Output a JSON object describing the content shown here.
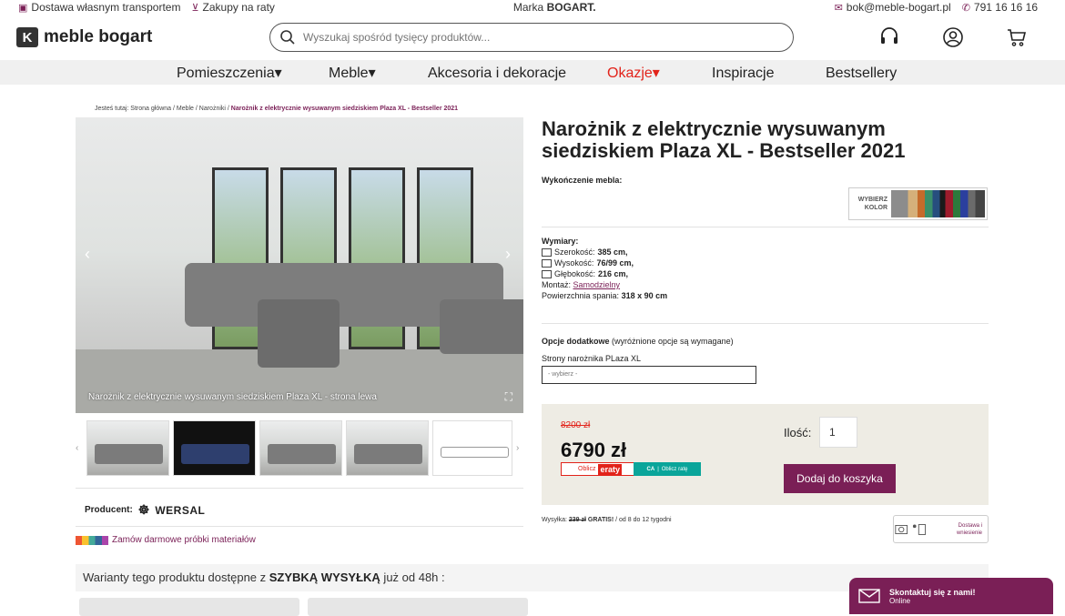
{
  "topbar": {
    "delivery": "Dostawa własnym transportem",
    "installments": "Zakupy na raty",
    "brand_prefix": "Marka ",
    "brand": "BOGART.",
    "email": "bok@meble-bogart.pl",
    "phone": "791 16 16 16"
  },
  "header": {
    "logo_text": "meble bogart",
    "search_placeholder": "Wyszukaj spośród tysięcy produktów..."
  },
  "nav": [
    {
      "label": "Pomieszczenia",
      "dropdown": true
    },
    {
      "label": "Meble",
      "dropdown": true
    },
    {
      "label": "Akcesoria i dekoracje",
      "dropdown": false
    },
    {
      "label": "Okazje",
      "dropdown": true,
      "highlight": true
    },
    {
      "label": "Inspiracje",
      "dropdown": false
    },
    {
      "label": "Bestsellery",
      "dropdown": false
    }
  ],
  "breadcrumb": {
    "prefix": "Jesteś tutaj: Strona główna / Meble / Narożniki / ",
    "current": "Narożnik z elektrycznie wysuwanym siedziskiem Plaza XL - Bestseller 2021"
  },
  "gallery": {
    "caption": "Narożnik z elektrycznie wysuwanym siedziskiem Plaza XL - strona lewa"
  },
  "producer": {
    "label": "Producent:",
    "name": "WERSAL"
  },
  "samples_link": "Zamów darmowe próbki materiałów",
  "variants": {
    "prefix": "Warianty tego produktu dostępne z ",
    "highlight": "SZYBKĄ WYSYŁKĄ",
    "suffix": " już od 48h :"
  },
  "product": {
    "title": "Narożnik z elektrycznie wysuwanym siedziskiem Plaza XL - Bestseller 2021",
    "finish_label": "Wykończenie mebla:",
    "color_pick": "WYBIERZ KOLOR",
    "dims_label": "Wymiary:",
    "width_label": "Szerokość: ",
    "width": "385 cm,",
    "height_label": "Wysokość: ",
    "height": "76/99 cm,",
    "depth_label": "Głębokość: ",
    "depth": "216 cm,",
    "assembly_label": "Montaż: ",
    "assembly": "Samodzielny",
    "sleep_label": "Powierzchnia spania: ",
    "sleep": "318 x 90 cm",
    "options_label": "Opcje dodatkowe",
    "options_note": " (wyróżnione opcje są wymagane)",
    "sides_label": "Strony narożnika PLaza XL",
    "select_placeholder": "- wybierz -"
  },
  "price": {
    "old": "8200 zł",
    "new": "6790 zł",
    "eraty_prefix": "Oblicz",
    "eraty_brand": "eraty",
    "ca_label": "Oblicz ratę",
    "qty_label": "Ilość:",
    "qty_value": "1",
    "add_to_cart": "Dodaj do koszyka"
  },
  "shipping": {
    "prefix": "Wysyłka: ",
    "old": "239 zł",
    "free": " GRATIS!",
    "suffix": " / od 8 do 12 tygodni",
    "badge": "Dostawa i wniesienie"
  },
  "contact": {
    "title": "Skontaktuj się z nami!",
    "status": "Online"
  },
  "colors": {
    "accent": "#7a1f56",
    "sale": "#e2231a",
    "price_bg": "#eeece4"
  }
}
